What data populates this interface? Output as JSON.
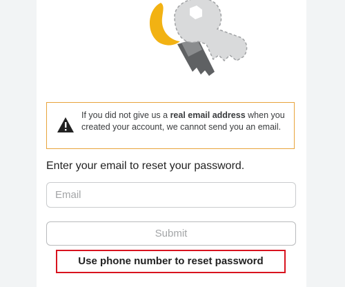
{
  "notice": {
    "text_before": "If you did not give us a ",
    "text_bold": "real email address",
    "text_after": " when you created your account, we cannot send you an email.",
    "icon": "warning-icon",
    "border_color": "#e8a33a"
  },
  "form": {
    "instruction": "Enter your email to reset your password.",
    "email_placeholder": "Email",
    "email_value": "",
    "submit_label": "Submit"
  },
  "alternate": {
    "phone_link_label": "Use phone number to reset password",
    "highlight_color": "#d8121e"
  },
  "illustration": {
    "icon": "key-icon"
  }
}
